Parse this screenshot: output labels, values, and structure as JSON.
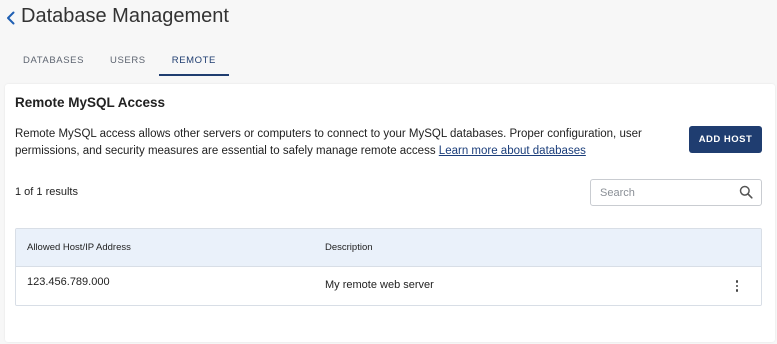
{
  "header": {
    "back_icon": "chevron-left-icon",
    "title": "Database Management"
  },
  "tabs": [
    {
      "label": "DATABASES",
      "active": false
    },
    {
      "label": "USERS",
      "active": false
    },
    {
      "label": "REMOTE",
      "active": true
    }
  ],
  "card": {
    "title": "Remote MySQL Access",
    "description": "Remote MySQL access allows other servers or computers to connect to your MySQL databases. Proper configuration, user permissions, and security measures are essential to safely manage remote access",
    "learn_more_link": "Learn more about databases",
    "add_button": "ADD HOST"
  },
  "results": {
    "count_text": "1 of 1 results"
  },
  "search": {
    "placeholder": "Search",
    "icon": "search-icon"
  },
  "table": {
    "columns": [
      "Allowed Host/IP Address",
      "Description"
    ],
    "rows": [
      {
        "host": "123.456.789.000",
        "description": "My remote web server",
        "actions_icon": "kebab-menu-icon"
      }
    ]
  },
  "colors": {
    "accent": "#1f3d70",
    "link": "#1a3d7a",
    "table_header_bg": "#eaf1fa",
    "page_bg": "#f7f7f7"
  }
}
